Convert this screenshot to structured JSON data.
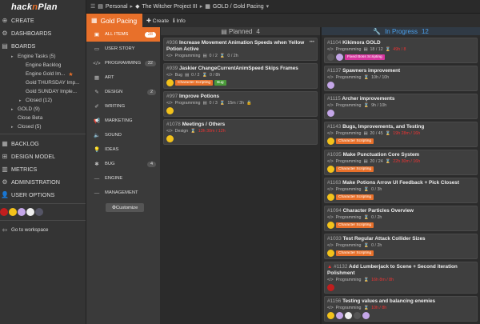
{
  "app": {
    "logo_a": "hack",
    "logo_n": "n",
    "logo_b": "Plan"
  },
  "nav": {
    "create": "CREATE",
    "dashboards": "DASHBOARDS",
    "boards": "BOARDS",
    "boards_sub": [
      {
        "label": "Engine Tasks (5)",
        "indent": 1,
        "caret": true
      },
      {
        "label": "Engine Backlog",
        "indent": 2
      },
      {
        "label": "Engine Gold Im...",
        "indent": 2,
        "star": true
      },
      {
        "label": "Gold THURSDAY Imp...",
        "indent": 2
      },
      {
        "label": "Gold SUNDAY Imple...",
        "indent": 2
      },
      {
        "label": "Closed (12)",
        "indent": 2,
        "caret": true
      },
      {
        "label": "GOLD (9)",
        "indent": 1,
        "caret": true
      },
      {
        "label": "Close Beta",
        "indent": 1
      },
      {
        "label": "Closed (5)",
        "indent": 1,
        "caret": true
      }
    ],
    "backlog": "BACKLOG",
    "design_model": "DESIGN MODEL",
    "metrics": "METRICS",
    "administration": "ADMINISTRATION",
    "user_options": "USER OPTIONS",
    "go_workspace": "Go to workspace"
  },
  "breadcrumb": {
    "personal": "Personal",
    "project": "The Witcher Project III",
    "board": "GOLD / Gold Pacing"
  },
  "subbar": {
    "title": "Gold Pacing",
    "create": "Create",
    "info": "Info"
  },
  "categories": [
    {
      "label": "ALL ITEMS",
      "count": "28",
      "icon": "▣",
      "active": true
    },
    {
      "label": "USER STORY",
      "count": "",
      "icon": "▭"
    },
    {
      "label": "PROGRAMMING",
      "count": "22",
      "icon": "</>"
    },
    {
      "label": "ART",
      "count": "",
      "icon": "▦"
    },
    {
      "label": "DESIGN",
      "count": "2",
      "icon": "✎"
    },
    {
      "label": "WRITING",
      "count": "",
      "icon": "✐"
    },
    {
      "label": "MARKETING",
      "count": "",
      "icon": "📢"
    },
    {
      "label": "SOUND",
      "count": "",
      "icon": "🔈"
    },
    {
      "label": "IDEAS",
      "count": "",
      "icon": "💡"
    },
    {
      "label": "BUG",
      "count": "4",
      "icon": "✱"
    },
    {
      "label": "ENGINE",
      "count": "",
      "icon": "—"
    },
    {
      "label": "MANAGEMENT",
      "count": "",
      "icon": "—"
    }
  ],
  "customize": "Customize",
  "planned": {
    "title": "Planned",
    "count": "4",
    "cards": [
      {
        "id": "#936",
        "title": "Increase Movement Animation Speeds when Yellow Potion Active",
        "cat": "Programming",
        "sub": "0 / 2",
        "time": "0 / 2h",
        "tags": [],
        "faces": [],
        "dots": true
      },
      {
        "id": "#939",
        "title": "Jaskier ChangeCurrentAnimSpeed Skips Frames",
        "cat": "Bug",
        "sub": "0 / 2",
        "time": "0 / 8h",
        "tags": [
          {
            "t": "Character Scripting",
            "c": "orange"
          },
          {
            "t": "Bug",
            "c": "green"
          }
        ],
        "faces": [
          "yellow"
        ]
      },
      {
        "id": "#997",
        "title": "Improve Potions",
        "cat": "Programming",
        "sub": "0 / 3",
        "time": "15m / 3h",
        "tags": [],
        "faces": [
          "yellow"
        ],
        "lock": true
      },
      {
        "id": "#1078",
        "title": "Meetings / Others",
        "cat": "Design",
        "sub": "",
        "time": "13h 30m / 12h",
        "red": true,
        "tags": [],
        "faces": [
          "yellow"
        ]
      }
    ]
  },
  "progress": {
    "title": "In Progress",
    "count": "12",
    "cards": [
      {
        "id": "#1104",
        "title": "Kikimora GOLD",
        "cat": "Programming",
        "sub": "18 / 12",
        "time": "49h / 8",
        "red": true,
        "tags": [
          {
            "t": "Fixed Boss Scripting",
            "c": "pink"
          }
        ],
        "faces": [
          "dark",
          "purple"
        ]
      },
      {
        "id": "#1137",
        "title": "Spawners improvement",
        "cat": "Programming",
        "sub": "",
        "time": "10h / 10h",
        "tags": [],
        "faces": [
          "purple"
        ]
      },
      {
        "id": "#1115",
        "title": "Archer improvements",
        "cat": "Programming",
        "sub": "",
        "time": "9h / 10h",
        "tags": [],
        "faces": [
          "purple"
        ]
      },
      {
        "id": "#1143",
        "title": "Bugs, Improvements, and Testing",
        "cat": "Programming",
        "sub": "20 / 45",
        "time": "19h 28m / 16h",
        "red": true,
        "tags": [
          {
            "t": "Character Scripting",
            "c": "orange"
          }
        ],
        "faces": [
          "yellow"
        ]
      },
      {
        "id": "#1035",
        "title": "Make Punctuation Core System",
        "cat": "Programming",
        "sub": "20 / 24",
        "time": "22h 30m / 16h",
        "red": true,
        "tags": [
          {
            "t": "Character Scripting",
            "c": "orange"
          }
        ],
        "faces": [
          "yellow"
        ]
      },
      {
        "id": "#1163",
        "title": "Make Potions Arrow UI Feedback + Pick Closest",
        "cat": "Programming",
        "sub": "",
        "time": "0 / 3h",
        "tags": [
          {
            "t": "Character Scripting",
            "c": "orange"
          }
        ],
        "faces": [
          "yellow"
        ]
      },
      {
        "id": "#1094",
        "title": "Character Particles Overview",
        "cat": "Programming",
        "sub": "",
        "time": "0 / 2h",
        "tags": [
          {
            "t": "Character Scripting",
            "c": "orange"
          }
        ],
        "faces": [
          "yellow"
        ]
      },
      {
        "id": "#1033",
        "title": "Test Regular Attack Collider Sizes",
        "cat": "Programming",
        "sub": "",
        "time": "0 / 2h",
        "tags": [
          {
            "t": "Character Scripting",
            "c": "orange"
          }
        ],
        "faces": [
          "yellow"
        ]
      },
      {
        "id": "#1132",
        "title": "Add Lumberjack to Scene + Second iteration Polishment",
        "cat": "Programming",
        "sub": "",
        "time": "16h 8m / 8h",
        "red": true,
        "warn": true,
        "tags": [],
        "faces": [
          "red"
        ]
      },
      {
        "id": "#1156",
        "title": "Testing values and balancing enemies",
        "cat": "Programming",
        "sub": "",
        "time": "10h / 8h",
        "red": true,
        "tags": [],
        "faces": [
          "yellow",
          "purple",
          "white",
          "dark",
          "purple"
        ]
      }
    ]
  }
}
